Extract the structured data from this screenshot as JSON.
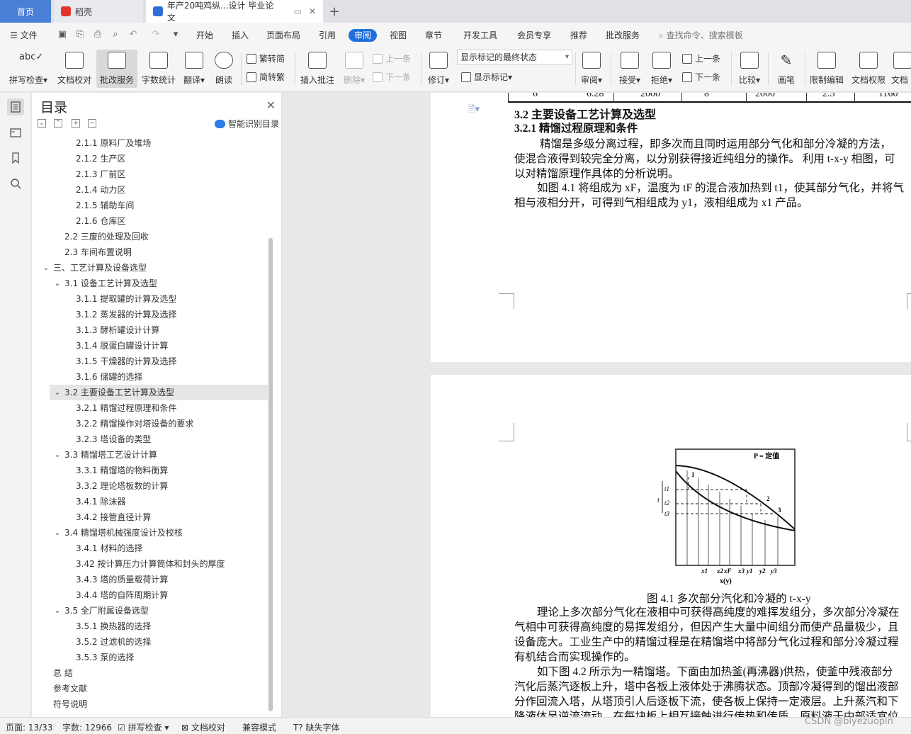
{
  "tabs": {
    "home": "首页",
    "daoke": "稻壳",
    "document": "年产20吨鸡纵...设计 毕业论文"
  },
  "menu": {
    "file": "文件",
    "items": [
      "开始",
      "插入",
      "页面布局",
      "引用",
      "审阅",
      "视图",
      "章节",
      "开发工具",
      "会员专享",
      "推荐",
      "批改服务"
    ],
    "active": "审阅",
    "search": "查找命令、搜索模板"
  },
  "ribbon": {
    "spell_check": "拼写检查",
    "doc_proof": "文档校对",
    "review_service": "批改服务",
    "word_count": "字数统计",
    "translate": "翻译",
    "read_aloud": "朗读",
    "trad_to_simp": "繁转简",
    "simp_to_trad": "简转繁",
    "insert_comment": "插入批注",
    "delete": "删除",
    "prev_comment": "上一条",
    "next_comment": "下一条",
    "track_changes": "修订",
    "markup_state": "显示标记的最终状态",
    "show_markup": "显示标记",
    "review": "审阅",
    "accept": "接受",
    "reject": "拒绝",
    "prev_change": "上一条",
    "next_change": "下一条",
    "compare": "比较",
    "pen": "画笔",
    "restrict_edit": "限制编辑",
    "doc_permission": "文档权限",
    "doc_more": "文档"
  },
  "toc": {
    "title": "目录",
    "smart": "智能识别目录",
    "items": [
      {
        "label": "2.1.1  原料厂及堆场",
        "level": 3
      },
      {
        "label": "2.1.2  生产区",
        "level": 3
      },
      {
        "label": "2.1.3  厂前区",
        "level": 3
      },
      {
        "label": "2.1.4  动力区",
        "level": 3
      },
      {
        "label": "2.1.5  辅助车间",
        "level": 3
      },
      {
        "label": "2.1.6  仓库区",
        "level": 3
      },
      {
        "label": "2.2  三废的处理及回收",
        "level": 2
      },
      {
        "label": "2.3  车间布置说明",
        "level": 2
      },
      {
        "label": "三、工艺计算及设备选型",
        "level": 1,
        "expanded": true
      },
      {
        "label": "3.1  设备工艺计算及选型",
        "level": 2,
        "expanded": true
      },
      {
        "label": "3.1.1  提取罐的计算及选型",
        "level": 3
      },
      {
        "label": "3.1.2  蒸发器的计算及选择",
        "level": 3
      },
      {
        "label": "3.1.3  酵析罐设计计算",
        "level": 3
      },
      {
        "label": "3.1.4  脱蛋白罐设计计算",
        "level": 3
      },
      {
        "label": "3.1.5  干燥器的计算及选择",
        "level": 3
      },
      {
        "label": "3.1.6  储罐的选择",
        "level": 3
      },
      {
        "label": "3.2  主要设备工艺计算及选型",
        "level": 2,
        "expanded": true,
        "selected": true
      },
      {
        "label": "3.2.1  精馏过程原理和条件",
        "level": 3
      },
      {
        "label": "3.2.2  精馏操作对塔设备的要求",
        "level": 3
      },
      {
        "label": "3.2.3  塔设备的类型",
        "level": 3
      },
      {
        "label": "3.3  精馏塔工艺设计计算",
        "level": 2,
        "expanded": true
      },
      {
        "label": "3.3.1  精馏塔的物料衡算",
        "level": 3
      },
      {
        "label": "3.3.2  理论塔板数的计算",
        "level": 3
      },
      {
        "label": "3.4.1  除沫器",
        "level": 3
      },
      {
        "label": "3.4.2  接管直径计算",
        "level": 3
      },
      {
        "label": "3.4  精馏塔机械强度设计及校核",
        "level": 2,
        "expanded": true
      },
      {
        "label": "3.4.1  材料的选择",
        "level": 3
      },
      {
        "label": "3.42  按计算压力计算筒体和封头的厚度",
        "level": 3
      },
      {
        "label": "3.4.3  塔的质量载荷计算",
        "level": 3
      },
      {
        "label": "3.4.4  塔的自阵周期计算",
        "level": 3
      },
      {
        "label": "3.5  全厂附属设备选型",
        "level": 2,
        "expanded": true
      },
      {
        "label": "3.5.1  换热器的选择",
        "level": 3
      },
      {
        "label": "3.5.2  过滤机的选择",
        "level": 3
      },
      {
        "label": "3.5.3  泵的选择",
        "level": 3
      },
      {
        "label": "总    结",
        "level": 0
      },
      {
        "label": "参考文献",
        "level": 0
      },
      {
        "label": "符号说明",
        "level": 0
      }
    ]
  },
  "document": {
    "table_row": [
      "6",
      "6.28",
      "2000",
      "8",
      "2000",
      "2.5",
      "1160"
    ],
    "heading_32": "3.2  主要设备工艺计算及选型",
    "heading_321": "3.2.1  精馏过程原理和条件",
    "para1_l1": "精馏是多级分离过程，即多次而且同时运用部分气化和部分冷凝的方法，",
    "para1_l2": "使混合液得到较完全分离，以分别获得接近纯组分的操作。 利用 t-x-y 相图，可",
    "para1_l3": "以对精馏原理作具体的分析说明。",
    "para2_l1": "如图 4.1 将组成为 xF，温度为 tF 的混合液加热到 t1，使其部分气化，并将气",
    "para2_l2": "相与液相分开，可得到气相组成为 y1，液相组成为 x1 产品。",
    "figure_p_label": "P = 定值",
    "figure_axis_t": "t",
    "figure_t_ticks": [
      "t1",
      "t2",
      "t3"
    ],
    "figure_x_ticks": [
      "x1",
      "x2",
      "xF",
      "x3",
      "y1",
      "y2",
      "y3"
    ],
    "figure_curve_labels": [
      "1",
      "2",
      "3"
    ],
    "figure_xlabel": "x(y)",
    "figure_caption": "图 4.1  多次部分汽化和冷凝的 t-x-y",
    "para3_l1": "理论上多次部分气化在液相中可获得高纯度的难挥发组分，多次部分冷凝在",
    "para3_l2": "气相中可获得高纯度的易挥发组分，但因产生大量中间组分而使产品量极少，且",
    "para3_l3": "设备庞大。工业生产中的精馏过程是在精馏塔中将部分气化过程和部分冷凝过程",
    "para3_l4": "有机结合而实现操作的。",
    "para4_l1": "如下图 4.2 所示为一精馏塔。下面由加热釜(再沸器)供热，使釜中残液部分",
    "para4_l2": "汽化后蒸汽逐板上升，塔中各板上液体处于沸腾状态。顶部冷凝得到的馏出液部",
    "para4_l3": "分作回流入塔，从塔顶引人后逐板下流，使各板上保持一定液层。上升蒸汽和下",
    "para4_l4": "降液体呈逆流流动，在每块板上相互接触进行传热和传质。原料液于中部适宜位"
  },
  "status": {
    "page": "页面: 13/33",
    "words": "字数: 12966",
    "spell": "拼写检查",
    "proof": "文档校对",
    "compat": "兼容模式",
    "missing_font": "缺失字体",
    "watermark": "CSDN @biyezuopin"
  },
  "colors": {
    "accent": "#1f6fdc",
    "home_tab": "#4a7fd6"
  }
}
